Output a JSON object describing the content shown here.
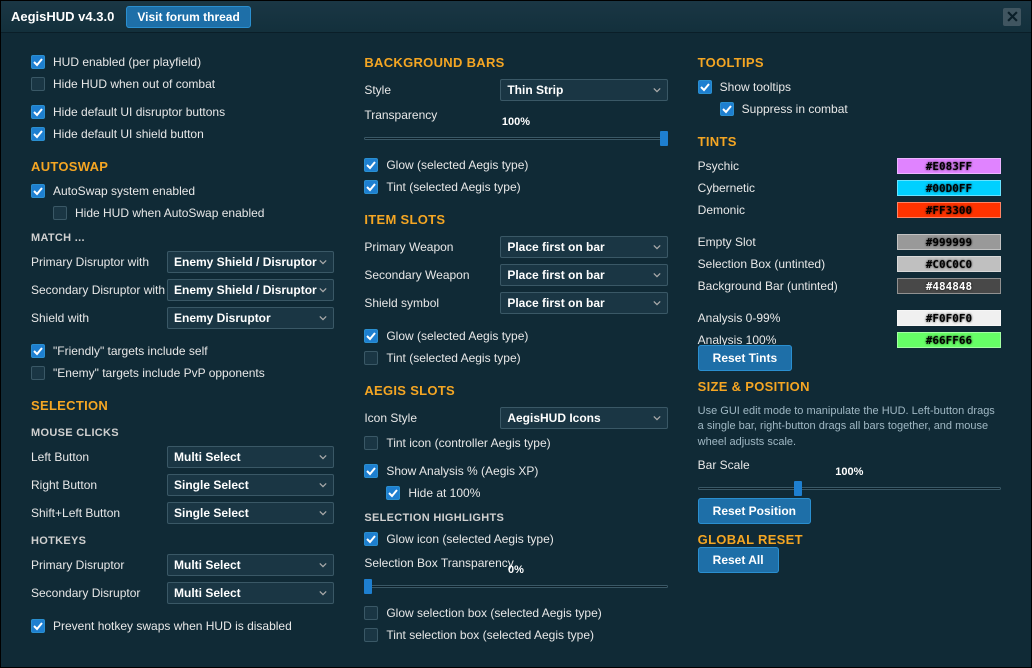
{
  "title": "AegisHUD v4.3.0",
  "forum_link": "Visit forum thread",
  "col1": {
    "hud_enabled": "HUD enabled (per playfield)",
    "hide_ooc": "Hide HUD when out of combat",
    "hide_disruptor_btns": "Hide default UI disruptor buttons",
    "hide_shield_btn": "Hide default UI shield button",
    "autoswap_h": "AUTOSWAP",
    "autoswap_enabled": "AutoSwap system enabled",
    "hide_when_autoswap": "Hide HUD when AutoSwap enabled",
    "match_h": "MATCH ...",
    "match_primary": "Primary Disruptor with",
    "match_secondary": "Secondary Disruptor with",
    "match_shield": "Shield with",
    "match_primary_val": "Enemy Shield / Disruptor",
    "match_secondary_val": "Enemy Shield / Disruptor",
    "match_shield_val": "Enemy Disruptor",
    "friendly_self": "\"Friendly\" targets include self",
    "enemy_pvp": "\"Enemy\" targets include PvP opponents",
    "selection_h": "SELECTION",
    "mouse_h": "MOUSE CLICKS",
    "left_btn": "Left Button",
    "right_btn": "Right Button",
    "shift_left": "Shift+Left Button",
    "left_val": "Multi Select",
    "right_val": "Single Select",
    "shift_val": "Single Select",
    "hotkeys_h": "HOTKEYS",
    "hk_primary": "Primary Disruptor",
    "hk_secondary": "Secondary Disruptor",
    "hk_primary_val": "Multi Select",
    "hk_secondary_val": "Multi Select",
    "prevent_swaps": "Prevent hotkey swaps when HUD is disabled"
  },
  "col2": {
    "bg_bars_h": "BACKGROUND BARS",
    "style": "Style",
    "style_val": "Thin Strip",
    "transparency": "Transparency",
    "trans_val": "100%",
    "glow_bg": "Glow (selected Aegis type)",
    "tint_bg": "Tint (selected Aegis type)",
    "item_slots_h": "ITEM SLOTS",
    "primary_w": "Primary Weapon",
    "secondary_w": "Secondary Weapon",
    "shield_sym": "Shield symbol",
    "primary_w_val": "Place first on bar",
    "secondary_w_val": "Place first on bar",
    "shield_sym_val": "Place first on bar",
    "glow_item": "Glow (selected Aegis type)",
    "tint_item": "Tint (selected Aegis type)",
    "aegis_slots_h": "AEGIS SLOTS",
    "icon_style": "Icon Style",
    "icon_style_val": "AegisHUD Icons",
    "tint_icon": "Tint icon (controller Aegis type)",
    "show_analysis": "Show Analysis % (Aegis XP)",
    "hide_100": "Hide at 100%",
    "sel_hl_h": "SELECTION HIGHLIGHTS",
    "glow_icon": "Glow icon (selected Aegis type)",
    "selbox_trans": "Selection Box Transparency",
    "selbox_trans_val": "0%",
    "glow_selbox": "Glow selection box (selected Aegis type)",
    "tint_selbox": "Tint selection box (selected Aegis type)"
  },
  "col3": {
    "tooltips_h": "TOOLTIPS",
    "show_tt": "Show tooltips",
    "suppress_tt": "Suppress in combat",
    "tints_h": "TINTS",
    "tints": [
      {
        "name": "Psychic",
        "color": "#E083FF",
        "text": "#000"
      },
      {
        "name": "Cybernetic",
        "color": "#00D0FF",
        "text": "#000"
      },
      {
        "name": "Demonic",
        "color": "#FF3300",
        "text": "#000"
      },
      {
        "name": "Empty Slot",
        "color": "#999999",
        "text": "#000"
      },
      {
        "name": "Selection Box (untinted)",
        "color": "#C0C0C0",
        "text": "#000"
      },
      {
        "name": "Background Bar (untinted)",
        "color": "#484848",
        "text": "#fff"
      },
      {
        "name": "Analysis 0-99%",
        "color": "#F0F0F0",
        "text": "#000"
      },
      {
        "name": "Analysis 100%",
        "color": "#66FF66",
        "text": "#000"
      }
    ],
    "reset_tints": "Reset Tints",
    "size_pos_h": "SIZE & POSITION",
    "size_pos_help": "Use GUI edit mode to manipulate the HUD.  Left-button drags a single bar, right-button drags all bars together, and mouse wheel adjusts scale.",
    "bar_scale": "Bar Scale",
    "bar_scale_val": "100%",
    "reset_pos": "Reset Position",
    "global_reset_h": "GLOBAL RESET",
    "reset_all": "Reset All"
  }
}
